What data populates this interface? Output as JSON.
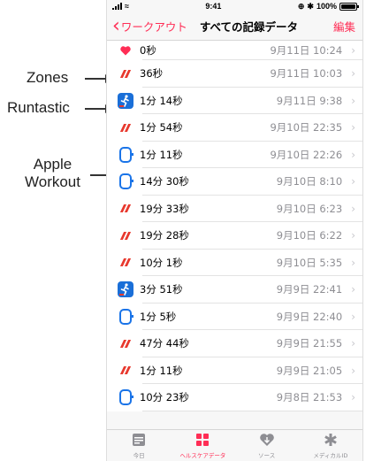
{
  "annotations": {
    "zones": "Zones",
    "runtastic": "Runtastic",
    "apple_line1": "Apple",
    "apple_line2": "Workout"
  },
  "status_bar": {
    "time": "9:41",
    "battery": "100%",
    "battery_level": 1.0
  },
  "navbar": {
    "back_label": "ワークアウト",
    "title": "すべての記録データ",
    "edit_label": "編集"
  },
  "colors": {
    "accent": "#ff2d55",
    "zones_red": "#e8392e",
    "runtastic_blue": "#1a6fd8",
    "apple_blue": "#1a74e8"
  },
  "rows": [
    {
      "source": "heart-icon",
      "duration": "0秒",
      "date": "9月11日 10:24"
    },
    {
      "source": "zones-icon",
      "duration": "36秒",
      "date": "9月11日 10:03"
    },
    {
      "source": "runtastic-icon",
      "duration": "1分 14秒",
      "date": "9月11日 9:38"
    },
    {
      "source": "zones-icon",
      "duration": "1分 54秒",
      "date": "9月10日 22:35"
    },
    {
      "source": "apple-watch-icon",
      "duration": "1分 11秒",
      "date": "9月10日 22:26"
    },
    {
      "source": "apple-watch-icon",
      "duration": "14分 30秒",
      "date": "9月10日 8:10"
    },
    {
      "source": "zones-icon",
      "duration": "19分 33秒",
      "date": "9月10日 6:23"
    },
    {
      "source": "zones-icon",
      "duration": "19分 28秒",
      "date": "9月10日 6:22"
    },
    {
      "source": "zones-icon",
      "duration": "10分 1秒",
      "date": "9月10日 5:35"
    },
    {
      "source": "runtastic-icon",
      "duration": "3分 51秒",
      "date": "9月9日 22:41"
    },
    {
      "source": "apple-watch-icon",
      "duration": "1分 5秒",
      "date": "9月9日 22:40"
    },
    {
      "source": "zones-icon",
      "duration": "47分 44秒",
      "date": "9月9日 21:55"
    },
    {
      "source": "zones-icon",
      "duration": "1分 11秒",
      "date": "9月9日 21:05"
    },
    {
      "source": "apple-watch-icon",
      "duration": "10分 23秒",
      "date": "9月8日 21:53"
    }
  ],
  "tabbar": [
    {
      "icon": "today-icon",
      "label": "今日"
    },
    {
      "icon": "health-data-icon",
      "label": "ヘルスケアデータ",
      "active": true
    },
    {
      "icon": "sources-icon",
      "label": "ソース"
    },
    {
      "icon": "medical-id-icon",
      "label": "メディカルID"
    }
  ]
}
